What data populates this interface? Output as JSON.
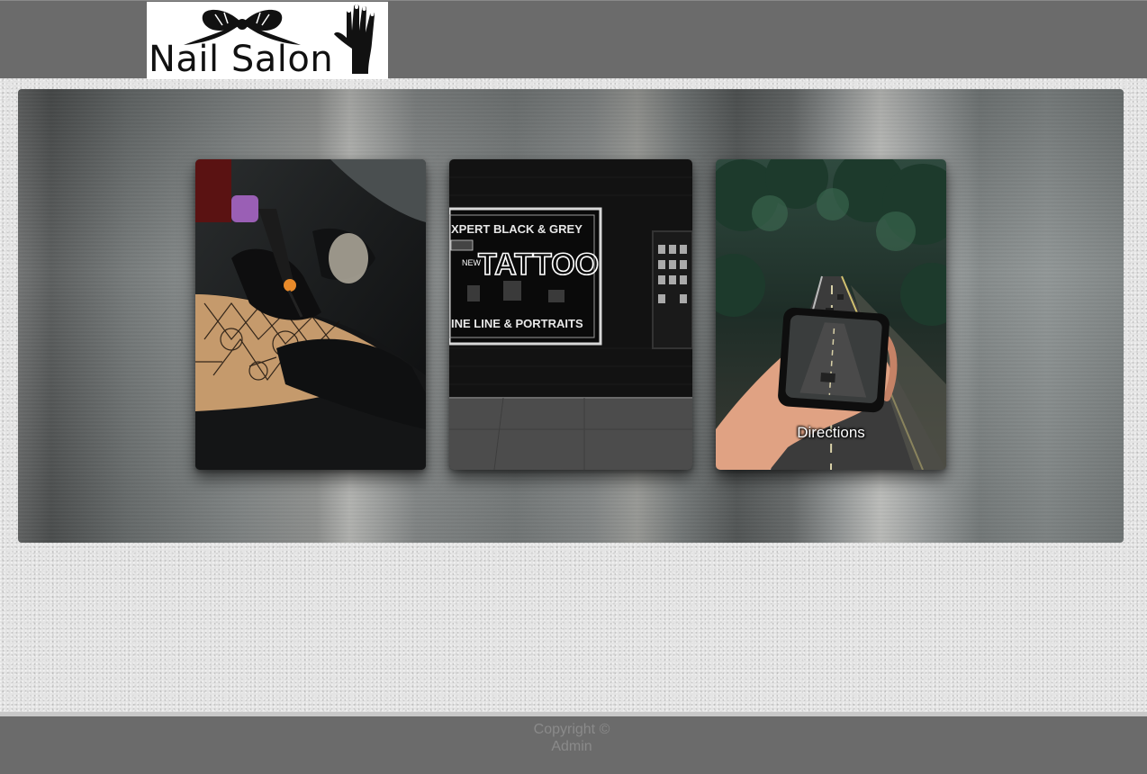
{
  "header": {
    "logo_text": "Nail Salon",
    "background_color": "#6b6b6b"
  },
  "hero": {
    "cards": [
      {
        "name": "tattoo-artist-image",
        "label": ""
      },
      {
        "name": "tattoo-shop-sign-image",
        "label": ""
      },
      {
        "name": "phone-road-image",
        "label": "Directions"
      }
    ]
  },
  "footer": {
    "copyright_line1": "Copyright ©",
    "copyright_line2": "Admin",
    "background_color": "#6b6b6b"
  }
}
